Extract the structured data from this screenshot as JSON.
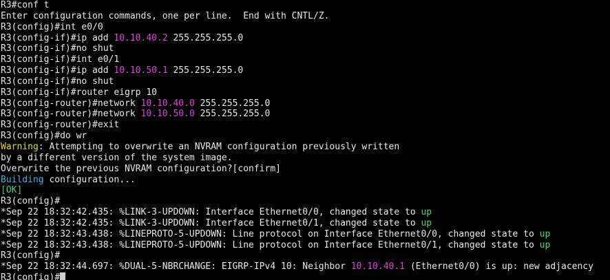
{
  "colors": {
    "background": "#000000",
    "text": "#e8e8e8",
    "ip": "#e040e0",
    "warning": "#e0e000",
    "info": "#3fb4e6",
    "ok": "#3fd67a"
  },
  "lines": [
    {
      "segments": [
        {
          "t": "R3#conf t"
        }
      ]
    },
    {
      "segments": [
        {
          "t": "Enter configuration commands, one per line.  End with CNTL/Z."
        }
      ]
    },
    {
      "segments": [
        {
          "t": "R3(config)#int e0/0"
        }
      ]
    },
    {
      "segments": [
        {
          "t": "R3(config-if)#ip add "
        },
        {
          "t": "10.10.40.2",
          "c": "ip"
        },
        {
          "t": " 255.255.255.0"
        }
      ]
    },
    {
      "segments": [
        {
          "t": "R3(config-if)#no shut"
        }
      ]
    },
    {
      "segments": [
        {
          "t": "R3(config-if)#int e0/1"
        }
      ]
    },
    {
      "segments": [
        {
          "t": "R3(config-if)#ip add "
        },
        {
          "t": "10.10.50.1",
          "c": "ip"
        },
        {
          "t": " 255.255.255.0"
        }
      ]
    },
    {
      "segments": [
        {
          "t": "R3(config-if)#no shut"
        }
      ]
    },
    {
      "segments": [
        {
          "t": "R3(config-if)#router eigrp 10"
        }
      ]
    },
    {
      "segments": [
        {
          "t": "R3(config-router)#network "
        },
        {
          "t": "10.10.40.0",
          "c": "ip"
        },
        {
          "t": " 255.255.255.0"
        }
      ]
    },
    {
      "segments": [
        {
          "t": "R3(config-router)#network "
        },
        {
          "t": "10.10.50.0",
          "c": "ip"
        },
        {
          "t": " 255.255.255.0"
        }
      ]
    },
    {
      "segments": [
        {
          "t": "R3(config-router)#exit"
        }
      ]
    },
    {
      "segments": [
        {
          "t": "R3(config)#do wr"
        }
      ]
    },
    {
      "segments": [
        {
          "t": "Warning",
          "c": "warn"
        },
        {
          "t": ": Attempting to overwrite an NVRAM configuration previously written"
        }
      ]
    },
    {
      "segments": [
        {
          "t": "by a different version of the system image."
        }
      ]
    },
    {
      "segments": [
        {
          "t": "Overwrite the previous NVRAM configuration?[confirm]"
        }
      ]
    },
    {
      "segments": [
        {
          "t": "Building",
          "c": "info"
        },
        {
          "t": " configuration..."
        }
      ]
    },
    {
      "segments": [
        {
          "t": "[",
          "c": "ok"
        },
        {
          "t": "OK",
          "c": "ok"
        },
        {
          "t": "]",
          "c": "ok"
        }
      ]
    },
    {
      "segments": [
        {
          "t": "R3(config)#"
        }
      ]
    },
    {
      "segments": [
        {
          "t": "*Sep 22 18:32:42.435: %LINK-3-UPDOWN: Interface Ethernet0/0, changed state to "
        },
        {
          "t": "up",
          "c": "up"
        }
      ]
    },
    {
      "segments": [
        {
          "t": "*Sep 22 18:32:42.435: %LINK-3-UPDOWN: Interface Ethernet0/1, changed state to "
        },
        {
          "t": "up",
          "c": "up"
        }
      ]
    },
    {
      "segments": [
        {
          "t": "*Sep 22 18:32:43.438: %LINEPROTO-5-UPDOWN: Line protocol on Interface Ethernet0/0, changed state to "
        },
        {
          "t": "up",
          "c": "up"
        }
      ]
    },
    {
      "segments": [
        {
          "t": "*Sep 22 18:32:43.438: %LINEPROTO-5-UPDOWN: Line protocol on Interface Ethernet0/1, changed state to "
        },
        {
          "t": "up",
          "c": "up"
        }
      ]
    },
    {
      "segments": [
        {
          "t": "R3(config)#"
        }
      ]
    },
    {
      "segments": [
        {
          "t": "*Sep 22 18:32:44.697: %DUAL-5-NBRCHANGE: EIGRP-IPv4 10: Neighbor "
        },
        {
          "t": "10.10.40.1",
          "c": "ip"
        },
        {
          "t": " (Ethernet0/0) is up: new adjacency"
        }
      ]
    },
    {
      "segments": [
        {
          "t": "R3(config)#"
        }
      ],
      "cursor": true
    }
  ]
}
